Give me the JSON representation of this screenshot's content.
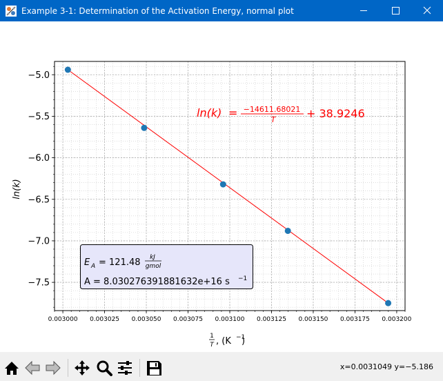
{
  "window": {
    "title": "Example 3-1: Determination of the Activation Energy, normal plot",
    "controls": [
      "minimize",
      "maximize",
      "close"
    ]
  },
  "plot": {
    "equation": {
      "lhs": "ln(k)",
      "equals": "=",
      "numerator": "−14611.68021",
      "denominator": "T",
      "constant": "+ 38.9246"
    },
    "info_box": {
      "ea_label": "E",
      "ea_sub": "A",
      "ea_eq": "= 121.48",
      "ea_unit_num": "kJ",
      "ea_unit_den": "gmol",
      "a_text": "A = 8.030276391881632e+16 s",
      "a_exp": "−1"
    },
    "colors": {
      "points": "#1f77b4",
      "fit_line": "#ff0000",
      "equation": "#ff0000",
      "box_fill": "#e6e6fa"
    }
  },
  "chart_data": {
    "type": "scatter",
    "title": "",
    "xlabel_num": "1",
    "xlabel_den": "T",
    "xlabel_units": ",  (K",
    "xlabel_exp": "−1",
    "xlabel_close": ")",
    "ylabel": "ln(k)",
    "xlim": [
      0.002995,
      0.003205
    ],
    "ylim": [
      -7.84,
      -4.84
    ],
    "x_ticks": [
      0.003,
      0.003025,
      0.00305,
      0.003075,
      0.0031,
      0.003125,
      0.00315,
      0.003175,
      0.0032
    ],
    "x_tick_labels": [
      "0.003000",
      "0.003025",
      "0.003050",
      "0.003075",
      "0.003100",
      "0.003125",
      "0.003150",
      "0.003175",
      "0.003200"
    ],
    "y_ticks": [
      -7.5,
      -7.0,
      -6.5,
      -6.0,
      -5.5,
      -5.0
    ],
    "y_tick_labels": [
      "−7.5",
      "−7.0",
      "−6.5",
      "−6.0",
      "−5.5",
      "−5.0"
    ],
    "minor_grid": true,
    "series": [
      {
        "x": [
          0.003003,
          0.0030487,
          0.003096,
          0.0031348,
          0.0031949
        ],
        "y": [
          -4.94,
          -5.64,
          -6.32,
          -6.88,
          -7.75
        ]
      }
    ],
    "fit": {
      "slope": -14611.68021,
      "intercept": 38.9246
    }
  },
  "toolbar": {
    "buttons": [
      "home-icon",
      "back-icon",
      "forward-icon",
      "pan-icon",
      "zoom-icon",
      "configure-icon",
      "save-icon"
    ],
    "coords_text": "x=0.0031049 y=−5.186"
  }
}
